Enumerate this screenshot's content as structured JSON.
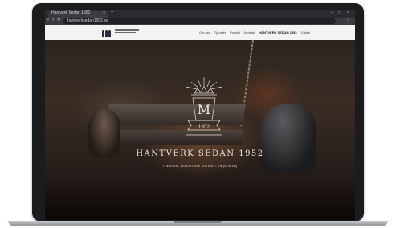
{
  "browser": {
    "tab_title": "Hantverk Sedan 1952",
    "tab_close": "×",
    "new_tab": "+",
    "window_controls": "–  □  ×",
    "nav": {
      "back": "‹",
      "forward": "›",
      "reload": "↻"
    },
    "url": "hantverksedan1952.se",
    "menu": "⋮"
  },
  "site": {
    "nav_items": [
      {
        "label": "Om oss"
      },
      {
        "label": "Tjänster"
      },
      {
        "label": "Projekt"
      },
      {
        "label": "Kontakt"
      },
      {
        "label": "HANTVERK SEDAN 1952",
        "strong": true
      },
      {
        "label": "Galleri"
      }
    ],
    "emblem_monogram": "M",
    "emblem_banner": "1952",
    "hero_title": "HANTVERK SEDAN 1952",
    "hero_subtitle": "Tradition, kvalitet och stolthet i varje detalj"
  },
  "colors": {
    "header_bg": "#f4f3f1",
    "hero_text": "#efe7dc",
    "logo": "#2c2c3a"
  },
  "icons": [
    "m-logo-icon",
    "crown-emblem-icon",
    "close-icon",
    "plus-icon",
    "back-icon",
    "forward-icon",
    "reload-icon",
    "menu-icon"
  ]
}
